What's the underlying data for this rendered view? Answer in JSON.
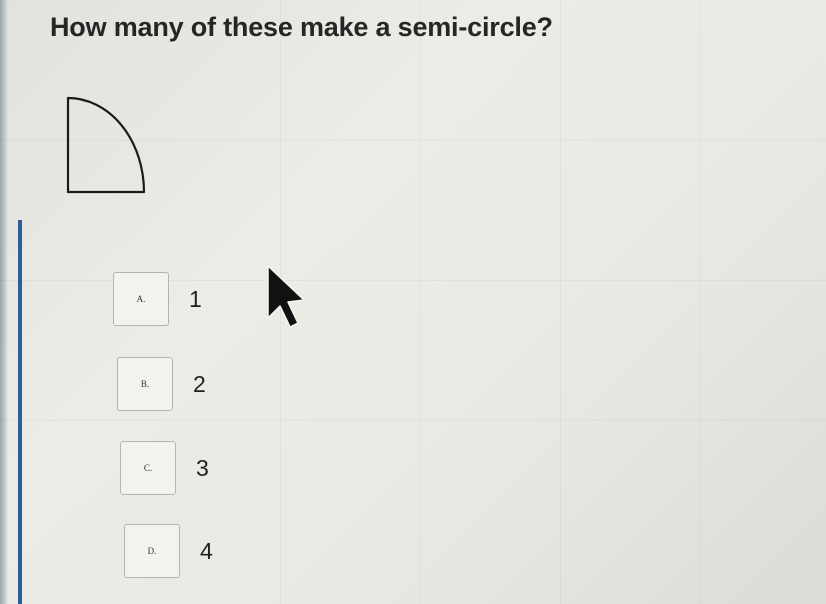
{
  "question": {
    "text": "How many of these make a semi-circle?"
  },
  "figure": {
    "shape": "quarter-circle"
  },
  "options": [
    {
      "letter": "A.",
      "value": "1"
    },
    {
      "letter": "B.",
      "value": "2"
    },
    {
      "letter": "C.",
      "value": "3"
    },
    {
      "letter": "D.",
      "value": "4"
    }
  ],
  "colors": {
    "background": "#e9e9e4",
    "text": "#262626",
    "accent_bar": "#2f5e96",
    "box_border": "#b4b4ae"
  },
  "cursor": {
    "icon": "arrow-cursor-icon"
  }
}
